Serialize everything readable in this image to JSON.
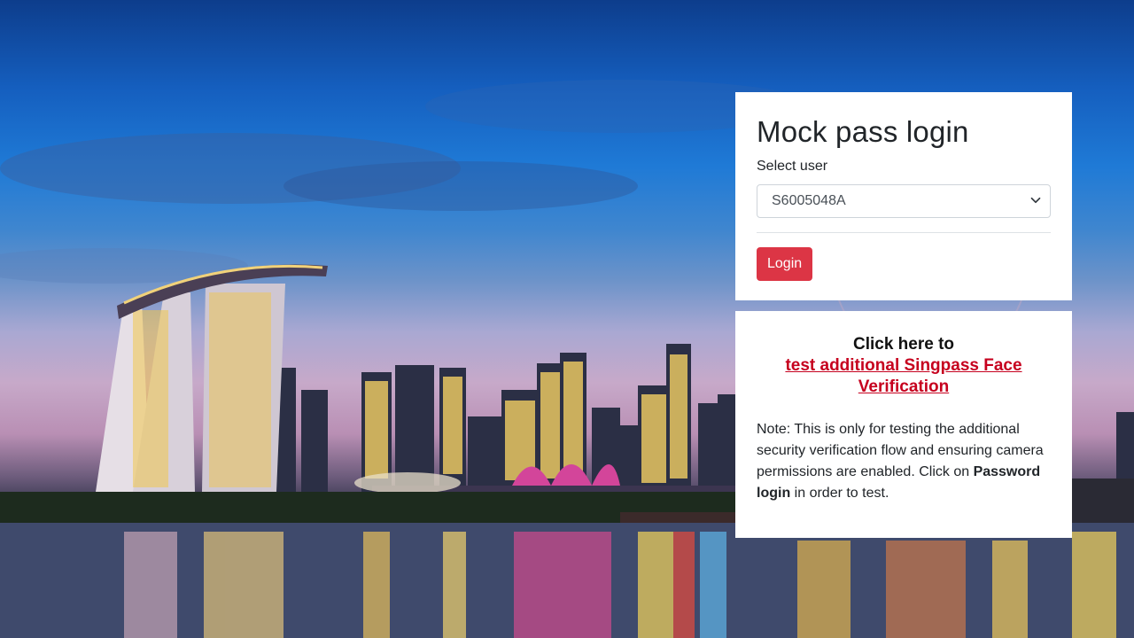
{
  "login": {
    "title": "Mock pass login",
    "select_label": "Select user",
    "selected_user": "S6005048A",
    "login_button": "Login"
  },
  "info": {
    "click_here": "Click here to",
    "link_text": "test additional Singpass Face Verification",
    "note_start": "Note: This is only for testing the additional security verification flow and ensuring camera permissions are enabled. Click on ",
    "note_bold": "Password login",
    "note_end": " in order to test."
  },
  "colors": {
    "login_button_bg": "#dc3545",
    "link": "#c6001e"
  },
  "icons": {
    "select_chevron": "chevron-down-icon"
  }
}
